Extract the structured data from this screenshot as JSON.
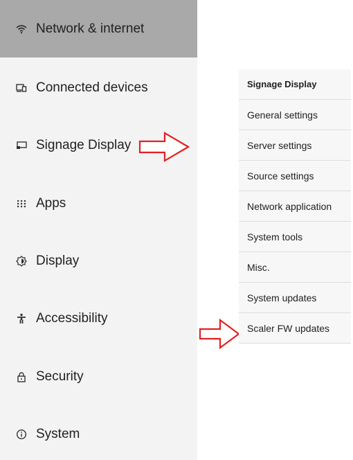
{
  "sidebar": {
    "items": [
      {
        "label": "Network & internet",
        "icon": "wifi-icon",
        "selected": true
      },
      {
        "label": "Connected devices",
        "icon": "devices-icon",
        "selected": false
      },
      {
        "label": "Signage Display",
        "icon": "signage-display-icon",
        "selected": false
      },
      {
        "label": "Apps",
        "icon": "apps-grid-icon",
        "selected": false
      },
      {
        "label": "Display",
        "icon": "display-brightness-icon",
        "selected": false
      },
      {
        "label": "Accessibility",
        "icon": "accessibility-icon",
        "selected": false
      },
      {
        "label": "Security",
        "icon": "lock-icon",
        "selected": false
      },
      {
        "label": "System",
        "icon": "info-icon",
        "selected": false
      }
    ]
  },
  "submenu": {
    "title": "Signage Display",
    "items": [
      "General settings",
      "Server settings",
      "Source settings",
      "Network application",
      "System tools",
      "Misc.",
      "System updates",
      "Scaler FW updates"
    ]
  },
  "colors": {
    "selected_background": "#a9a9a9",
    "sidebar_background": "#f3f3f3",
    "arrow_outline": "#e02020"
  }
}
